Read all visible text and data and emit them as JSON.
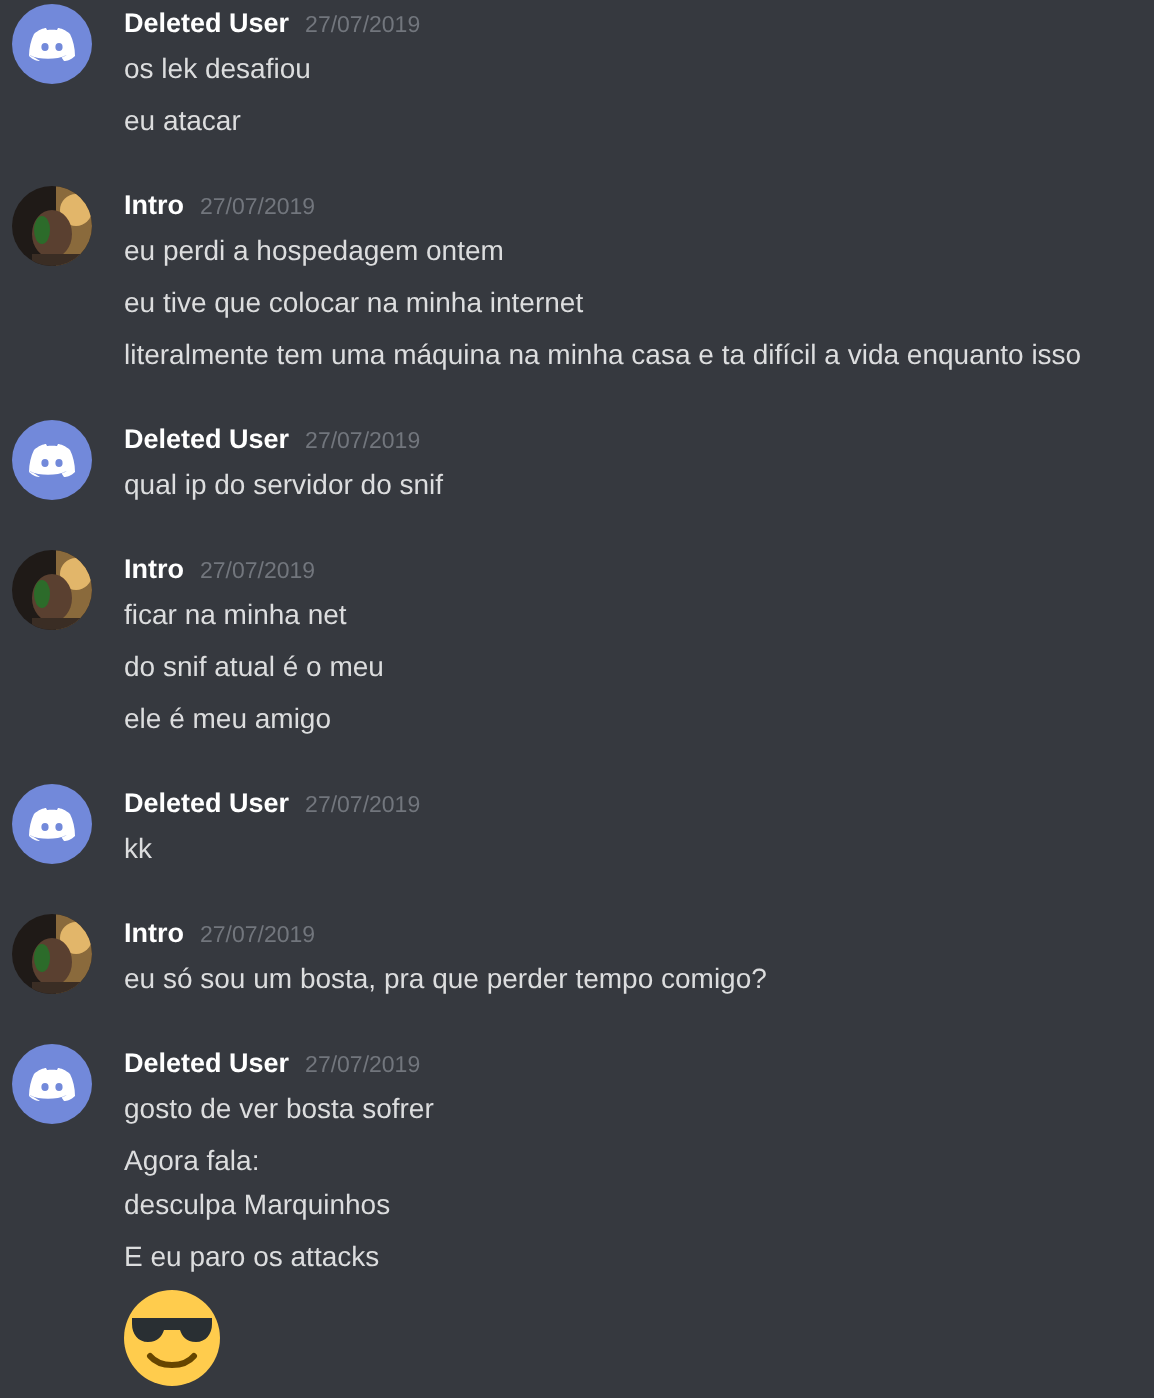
{
  "messages": [
    {
      "author": "Deleted User",
      "avatar": {
        "kind": "default"
      },
      "timestamp": "27/07/2019",
      "lines": [
        {
          "kind": "text",
          "text": "os lek desafiou"
        },
        {
          "kind": "text",
          "text": "eu atacar"
        }
      ]
    },
    {
      "author": "Intro",
      "avatar": {
        "kind": "picture"
      },
      "timestamp": "27/07/2019",
      "lines": [
        {
          "kind": "text",
          "text": "eu perdi a hospedagem ontem"
        },
        {
          "kind": "text",
          "text": "eu tive que colocar na minha internet"
        },
        {
          "kind": "text",
          "text": "literalmente tem uma máquina na minha casa e ta difícil a vida enquanto isso"
        }
      ]
    },
    {
      "author": "Deleted User",
      "avatar": {
        "kind": "default"
      },
      "timestamp": "27/07/2019",
      "lines": [
        {
          "kind": "text",
          "text": "qual ip do servidor do snif"
        }
      ]
    },
    {
      "author": "Intro",
      "avatar": {
        "kind": "picture"
      },
      "timestamp": "27/07/2019",
      "lines": [
        {
          "kind": "text",
          "text": "ficar na minha net"
        },
        {
          "kind": "text",
          "text": "do snif atual é o meu"
        },
        {
          "kind": "text",
          "text": "ele é meu amigo"
        }
      ]
    },
    {
      "author": "Deleted User",
      "avatar": {
        "kind": "default"
      },
      "timestamp": "27/07/2019",
      "lines": [
        {
          "kind": "text",
          "text": "kk"
        }
      ]
    },
    {
      "author": "Intro",
      "avatar": {
        "kind": "picture"
      },
      "timestamp": "27/07/2019",
      "lines": [
        {
          "kind": "text",
          "text": "eu só sou um bosta, pra que perder tempo comigo?"
        }
      ]
    },
    {
      "author": "Deleted User",
      "avatar": {
        "kind": "default"
      },
      "timestamp": "27/07/2019",
      "lines": [
        {
          "kind": "text",
          "text": "gosto de ver bosta sofrer"
        },
        {
          "kind": "text",
          "text": "Agora fala:\ndesculpa Marquinhos"
        },
        {
          "kind": "text",
          "text": "E eu paro os attacks"
        },
        {
          "kind": "emoji"
        }
      ]
    }
  ]
}
